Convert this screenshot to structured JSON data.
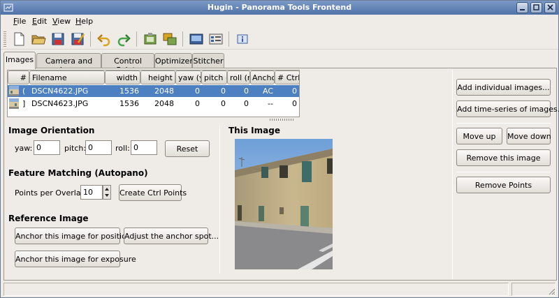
{
  "window": {
    "title": "Hugin - Panorama Tools Frontend"
  },
  "menu": {
    "items": [
      {
        "label": "File",
        "mnemonic": "F",
        "rest": "ile"
      },
      {
        "label": "Edit",
        "mnemonic": "E",
        "rest": "dit"
      },
      {
        "label": "View",
        "mnemonic": "V",
        "rest": "iew"
      },
      {
        "label": "Help",
        "mnemonic": "H",
        "rest": "elp"
      }
    ]
  },
  "toolbar": {
    "icons": [
      "new-icon",
      "open-icon",
      "save-icon",
      "save-as-icon",
      "undo-icon",
      "redo-icon",
      "assistant-icon",
      "batch-icon",
      "preview-icon",
      "fast-preview-icon",
      "info-icon"
    ]
  },
  "tabs": [
    "Images",
    "Camera and Lens",
    "Control Points",
    "Optimizer",
    "Stitcher"
  ],
  "image_list": {
    "columns": [
      "#",
      "Filename",
      "width",
      "height",
      "yaw (y",
      "pitch (",
      "roll (r)",
      "Anchor",
      "# Ctrl I"
    ],
    "rows": [
      {
        "num": "(",
        "filename": "DSCN4622.JPG",
        "width": "1536",
        "height": "2048",
        "yaw": "0",
        "pitch": "0",
        "roll": "0",
        "anchor": "AC",
        "ctrl": "0",
        "selected": true
      },
      {
        "num": "]",
        "filename": "DSCN4623.JPG",
        "width": "1536",
        "height": "2048",
        "yaw": "0",
        "pitch": "0",
        "roll": "0",
        "anchor": "--",
        "ctrl": "0",
        "selected": false
      }
    ]
  },
  "side_buttons": {
    "add_individual": "Add individual images...",
    "add_time_series": "Add time-series of images...",
    "move_up": "Move up",
    "move_down": "Move down",
    "remove_image": "Remove this image",
    "remove_points": "Remove Points"
  },
  "orientation": {
    "heading": "Image Orientation",
    "yaw_label": "yaw:",
    "yaw_value": "0",
    "pitch_label": "pitch:",
    "pitch_value": "0",
    "roll_label": "roll:",
    "roll_value": "0",
    "reset": "Reset"
  },
  "feature_matching": {
    "heading": "Feature Matching (Autopano)",
    "points_label": "Points per Overlap:",
    "points_value": "10",
    "create_button": "Create Ctrl Points"
  },
  "reference": {
    "heading": "Reference Image",
    "anchor_position": "Anchor this image for position",
    "adjust_anchor": "Adjust the anchor spot...",
    "anchor_exposure": "Anchor this image for exposure"
  },
  "preview": {
    "heading": "This Image"
  },
  "colors": {
    "selection": "#4d80c0",
    "titlebar": "#5a7db3"
  }
}
